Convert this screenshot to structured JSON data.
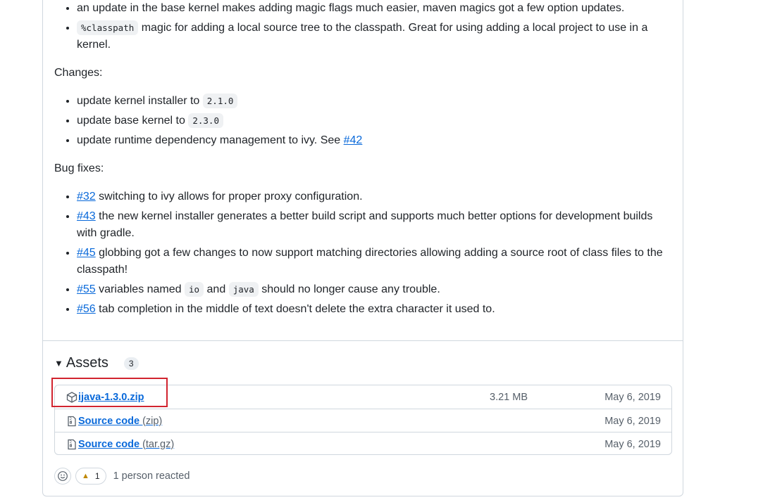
{
  "release_notes": {
    "top_items": [
      {
        "text": "an update in the base kernel makes adding magic flags much easier, maven magics got a few option updates."
      },
      {
        "code": "%classpath",
        "text": "magic for adding a local source tree to the classpath. Great for using adding a local project to use in a kernel."
      }
    ],
    "changes_heading": "Changes:",
    "changes": [
      {
        "text": "update kernel installer to",
        "code": "2.1.0"
      },
      {
        "text": "update base kernel to",
        "code": "2.3.0"
      },
      {
        "text": "update runtime dependency management to ivy. See",
        "link": "#42"
      }
    ],
    "bugfixes_heading": "Bug fixes:",
    "bugfixes": [
      {
        "link": "#32",
        "text": "switching to ivy allows for proper proxy configuration."
      },
      {
        "link": "#43",
        "text": "the new kernel installer generates a better build script and supports much better options for development builds with gradle."
      },
      {
        "link": "#45",
        "text": "globbing got a few changes to now support matching directories allowing adding a source root of class files to the classpath!"
      },
      {
        "link": "#55",
        "text_a": "variables named",
        "code_a": "io",
        "text_b": "and",
        "code_b": "java",
        "text_c": "should no longer cause any trouble."
      },
      {
        "link": "#56",
        "text": "tab completion in the middle of text doesn't delete the extra character it used to."
      }
    ]
  },
  "assets": {
    "title": "Assets",
    "count": "3",
    "rows": [
      {
        "name": "ijava-1.3.0.zip",
        "ext": "",
        "size": "3.21 MB",
        "date": "May 6, 2019",
        "icon": "package-icon"
      },
      {
        "name": "Source code",
        "ext": "(zip)",
        "size": "",
        "date": "May 6, 2019",
        "icon": "file-zip-icon"
      },
      {
        "name": "Source code",
        "ext": "(tar.gz)",
        "size": "",
        "date": "May 6, 2019",
        "icon": "file-zip-icon"
      }
    ]
  },
  "reactions": {
    "count": "1",
    "summary": "1 person reacted",
    "emoji": "tada"
  },
  "colors": {
    "link": "#0969da",
    "highlight": "#d1242f",
    "border": "#d0d7de"
  }
}
